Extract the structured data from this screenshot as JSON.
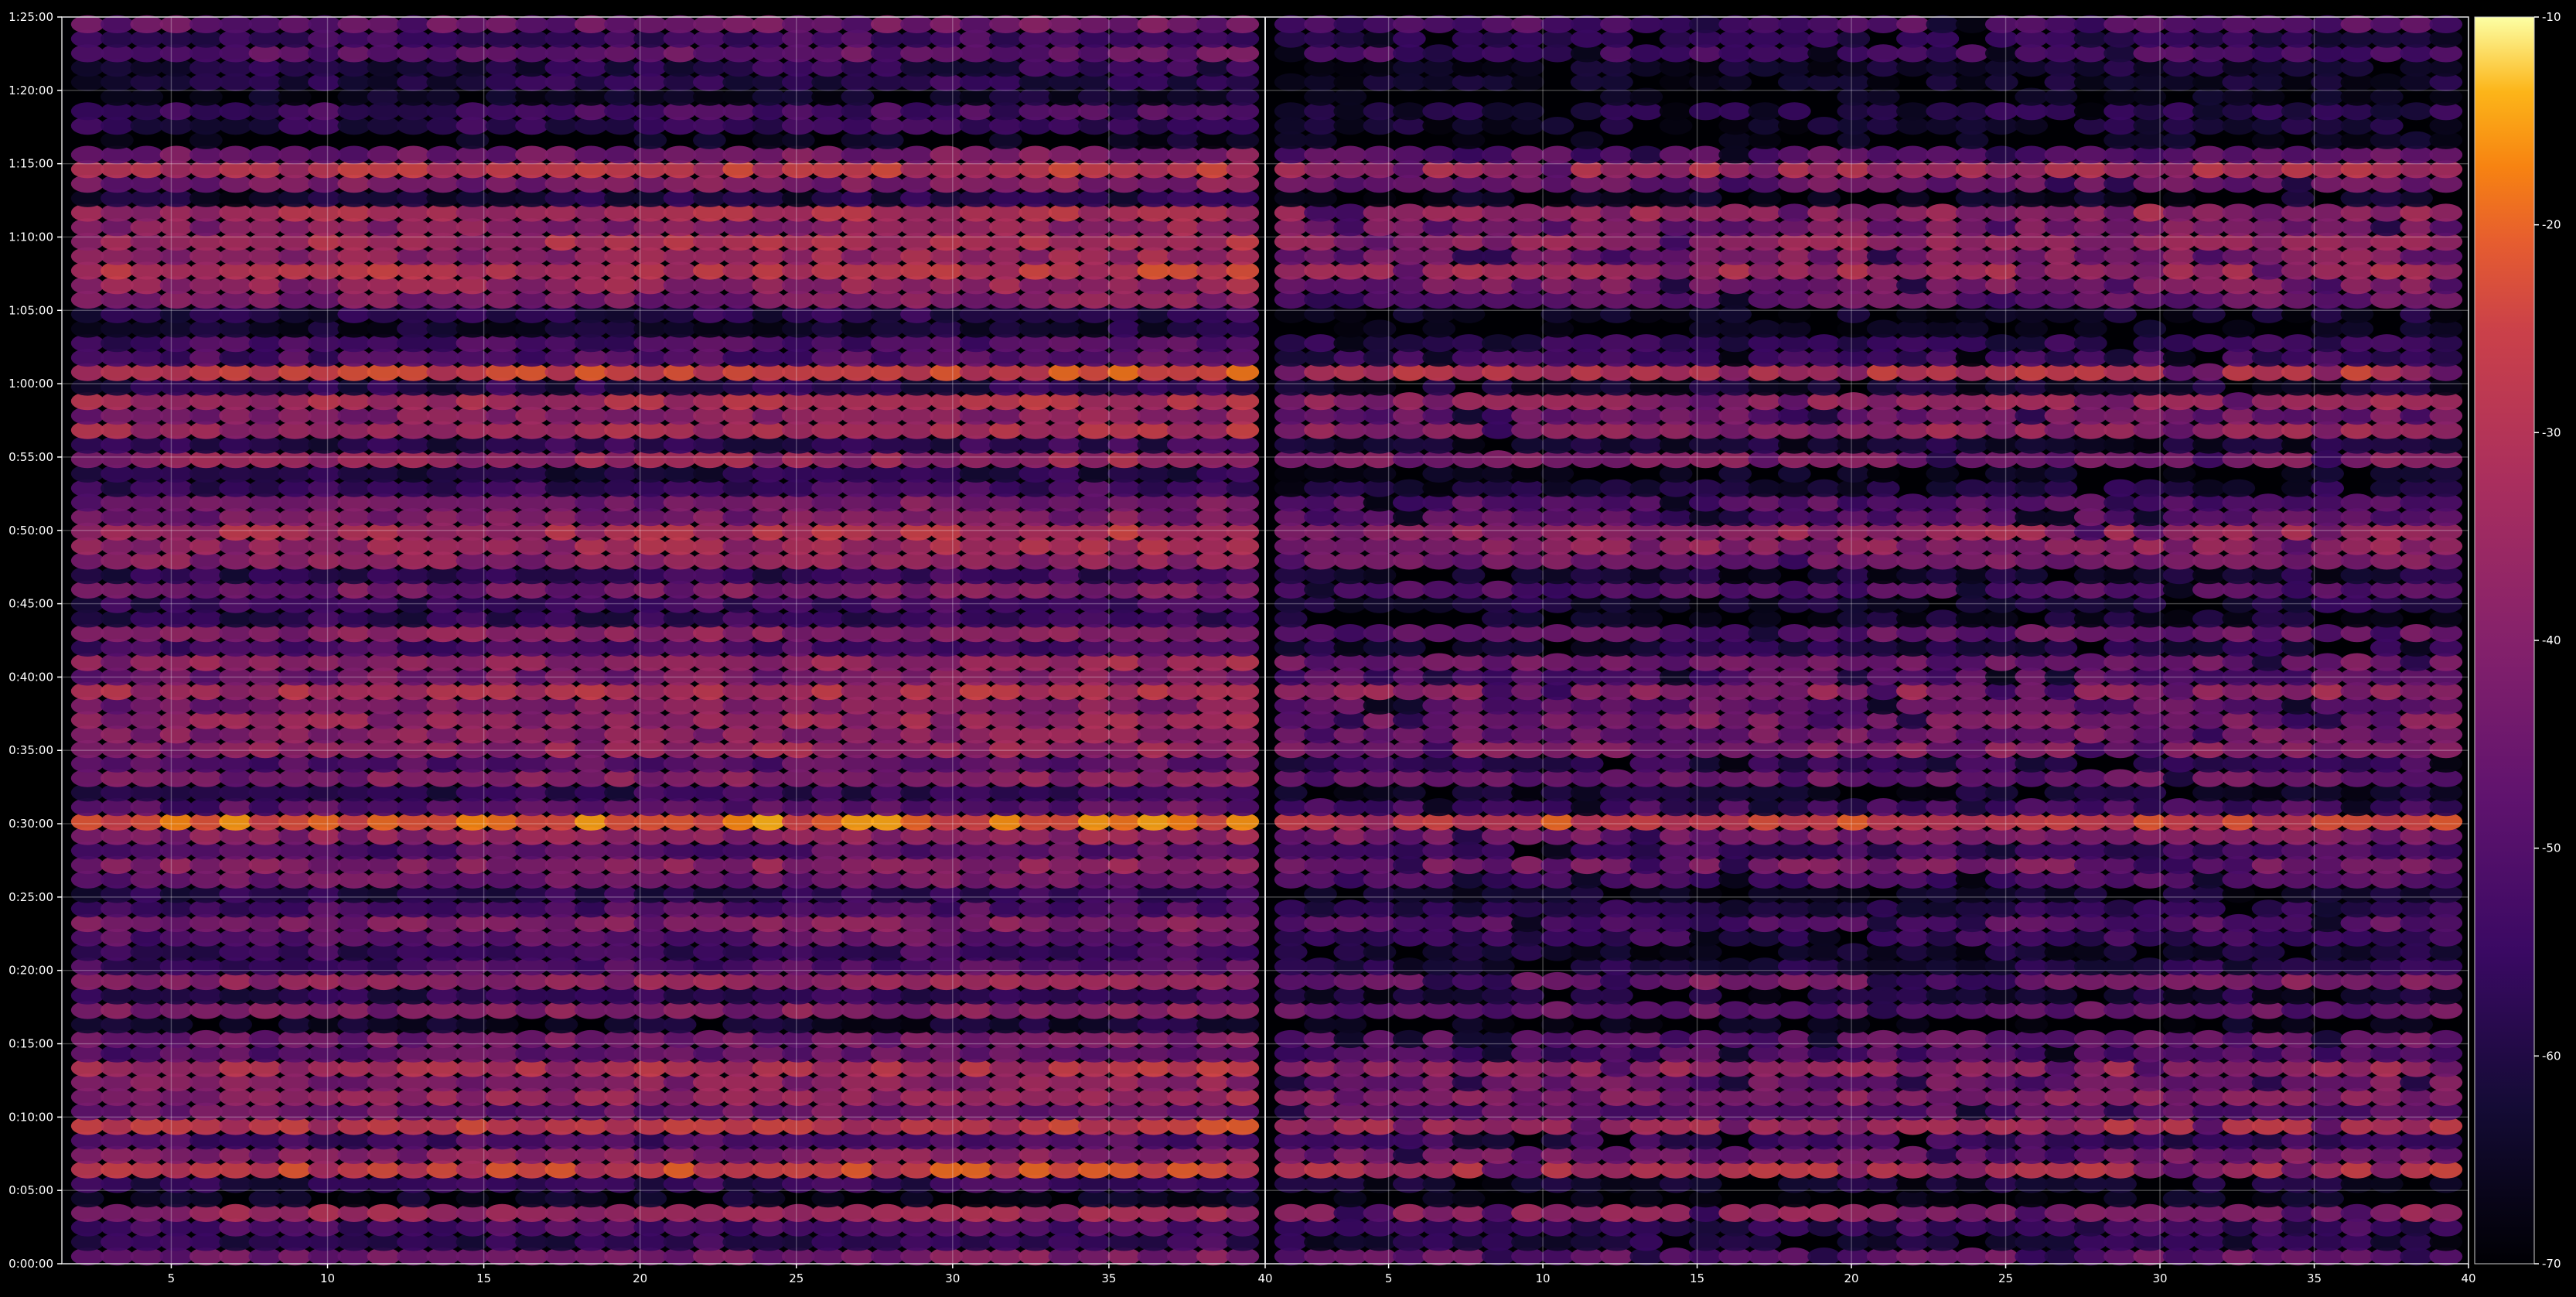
{
  "chart_data": {
    "type": "heatmap",
    "title": "",
    "xlabel": "",
    "ylabel": "",
    "panels": [
      {
        "name": "",
        "x_range": [
          1.5,
          40
        ],
        "x_ticks": [
          5,
          10,
          15,
          20,
          25,
          30,
          35,
          40
        ]
      },
      {
        "name": "",
        "x_range": [
          1,
          40
        ],
        "x_ticks": [
          5,
          10,
          15,
          20,
          25,
          30,
          35,
          40
        ]
      }
    ],
    "y_range_minutes": [
      0,
      85
    ],
    "y_ticks": [
      {
        "value": 0,
        "label": "0:00:00"
      },
      {
        "value": 5,
        "label": "0:05:00"
      },
      {
        "value": 10,
        "label": "0:10:00"
      },
      {
        "value": 15,
        "label": "0:15:00"
      },
      {
        "value": 20,
        "label": "0:20:00"
      },
      {
        "value": 25,
        "label": "0:25:00"
      },
      {
        "value": 30,
        "label": "0:30:00"
      },
      {
        "value": 35,
        "label": "0:35:00"
      },
      {
        "value": 40,
        "label": "0:40:00"
      },
      {
        "value": 45,
        "label": "0:45:00"
      },
      {
        "value": 50,
        "label": "0:50:00"
      },
      {
        "value": 55,
        "label": "0:55:00"
      },
      {
        "value": 60,
        "label": "1:00:00"
      },
      {
        "value": 65,
        "label": "1:05:00"
      },
      {
        "value": 70,
        "label": "1:10:00"
      },
      {
        "value": 75,
        "label": "1:15:00"
      },
      {
        "value": 80,
        "label": "1:20:00"
      },
      {
        "value": 85,
        "label": "1:25:00"
      }
    ],
    "colorbar": {
      "colormap": "inferno",
      "range": [
        -70,
        -10
      ],
      "ticks": [
        -10,
        -20,
        -30,
        -40,
        -50,
        -60,
        -70
      ]
    },
    "grid": true,
    "row_step_minutes": 1,
    "row_intensity_left": [
      -44,
      -58,
      -53,
      -36,
      -68,
      -58,
      -28,
      -41,
      -53,
      -30,
      -46,
      -38,
      -41,
      -34,
      -49,
      -45,
      -66,
      -42,
      -59,
      -38,
      -53,
      -56,
      -49,
      -43,
      -53,
      -59,
      -46,
      -40,
      -51,
      -39,
      -22,
      -50,
      -58,
      -42,
      -50,
      -38,
      -40,
      -38,
      -43,
      -33,
      -44,
      -38,
      -54,
      -40,
      -58,
      -56,
      -44,
      -58,
      -40,
      -36,
      -33,
      -44,
      -45,
      -56,
      -62,
      -38,
      -59,
      -34,
      -41,
      -34,
      -60,
      -28,
      -52,
      -53,
      -65,
      -60,
      -43,
      -38,
      -31,
      -38,
      -34,
      -40,
      -34,
      -63,
      -43,
      -31,
      -45,
      -70,
      -58,
      -55,
      -68,
      -60,
      -60,
      -49,
      -56,
      -47
    ],
    "row_intensity_right": [
      -47,
      -61,
      -56,
      -39,
      -70,
      -64,
      -31,
      -44,
      -56,
      -33,
      -49,
      -41,
      -44,
      -37,
      -52,
      -48,
      -70,
      -48,
      -64,
      -43,
      -61,
      -64,
      -56,
      -50,
      -60,
      -66,
      -52,
      -44,
      -55,
      -43,
      -26,
      -54,
      -64,
      -47,
      -56,
      -42,
      -45,
      -43,
      -48,
      -38,
      -50,
      -45,
      -61,
      -48,
      -65,
      -62,
      -50,
      -64,
      -44,
      -39,
      -37,
      -49,
      -50,
      -62,
      -68,
      -42,
      -64,
      -38,
      -46,
      -38,
      -64,
      -31,
      -56,
      -58,
      -70,
      -65,
      -48,
      -43,
      -35,
      -42,
      -38,
      -44,
      -37,
      -68,
      -46,
      -34,
      -49,
      -70,
      -64,
      -61,
      -70,
      -65,
      -65,
      -53,
      -60,
      -51
    ]
  }
}
